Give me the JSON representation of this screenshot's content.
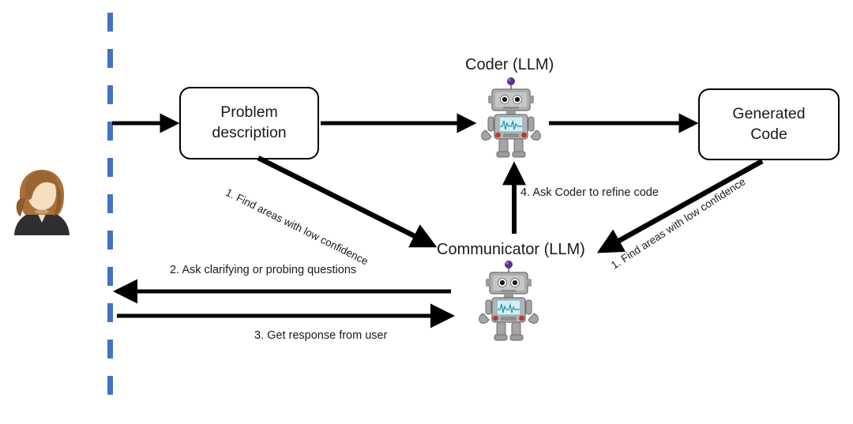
{
  "diagram": {
    "title": "Coder/Communicator LLM interaction flow",
    "colors": {
      "divider": "#4472C4",
      "arrow": "#000000",
      "box_border": "#000000",
      "box_fill": "#FFFFFF",
      "text": "#1A1A1A",
      "robot_body": "#9E9E9E",
      "robot_antenna": "#5B2D8E",
      "robot_screen": "#CFEFF5",
      "robot_button": "#C0392B",
      "avatar_hair": "#A9713A",
      "avatar_skin": "#F3D3AE",
      "avatar_jacket": "#2B2B2B"
    },
    "boxes": [
      {
        "id": "problem",
        "line1": "Problem",
        "line2": "description"
      },
      {
        "id": "generated_code",
        "line1": "Generated",
        "line2": "Code"
      }
    ],
    "actors": [
      {
        "id": "user",
        "icon": "user-avatar-icon",
        "label": ""
      },
      {
        "id": "coder",
        "icon": "robot-icon",
        "label": "Coder (LLM)"
      },
      {
        "id": "communicator",
        "icon": "robot-icon",
        "label": "Communicator (LLM)"
      }
    ],
    "edges": [
      {
        "id": "user-to-problem",
        "label": "",
        "from": "user",
        "to": "problem",
        "style": "straight-right"
      },
      {
        "id": "problem-to-coder",
        "label": "",
        "from": "problem",
        "to": "coder",
        "style": "straight-right"
      },
      {
        "id": "coder-to-code",
        "label": "",
        "from": "coder",
        "to": "generated_code",
        "style": "straight-right"
      },
      {
        "id": "problem-to-communicator",
        "label": "1. Find areas with low confidence",
        "from": "problem",
        "to": "communicator",
        "style": "diagonal-down-right"
      },
      {
        "id": "code-to-communicator",
        "label": "1. Find areas with low confidence",
        "from": "generated_code",
        "to": "communicator",
        "style": "diagonal-down-left"
      },
      {
        "id": "communicator-to-user",
        "label": "2. Ask clarifying or probing questions",
        "from": "communicator",
        "to": "user",
        "style": "straight-left"
      },
      {
        "id": "user-to-communicator",
        "label": "3. Get response from user",
        "from": "user",
        "to": "communicator",
        "style": "straight-right"
      },
      {
        "id": "communicator-to-coder",
        "label": "4. Ask Coder to refine code",
        "from": "communicator",
        "to": "coder",
        "style": "straight-up"
      }
    ],
    "labels": {
      "coder_title": "Coder (LLM)",
      "communicator_title": "Communicator (LLM)",
      "problem_line1": "Problem",
      "problem_line2": "description",
      "code_line1": "Generated",
      "code_line2": "Code",
      "step1_left": "1. Find areas with low confidence",
      "step1_right": "1. Find areas with low confidence",
      "step2": "2. Ask clarifying or probing questions",
      "step3": "3. Get response from user",
      "step4": "4. Ask Coder to refine code"
    }
  }
}
